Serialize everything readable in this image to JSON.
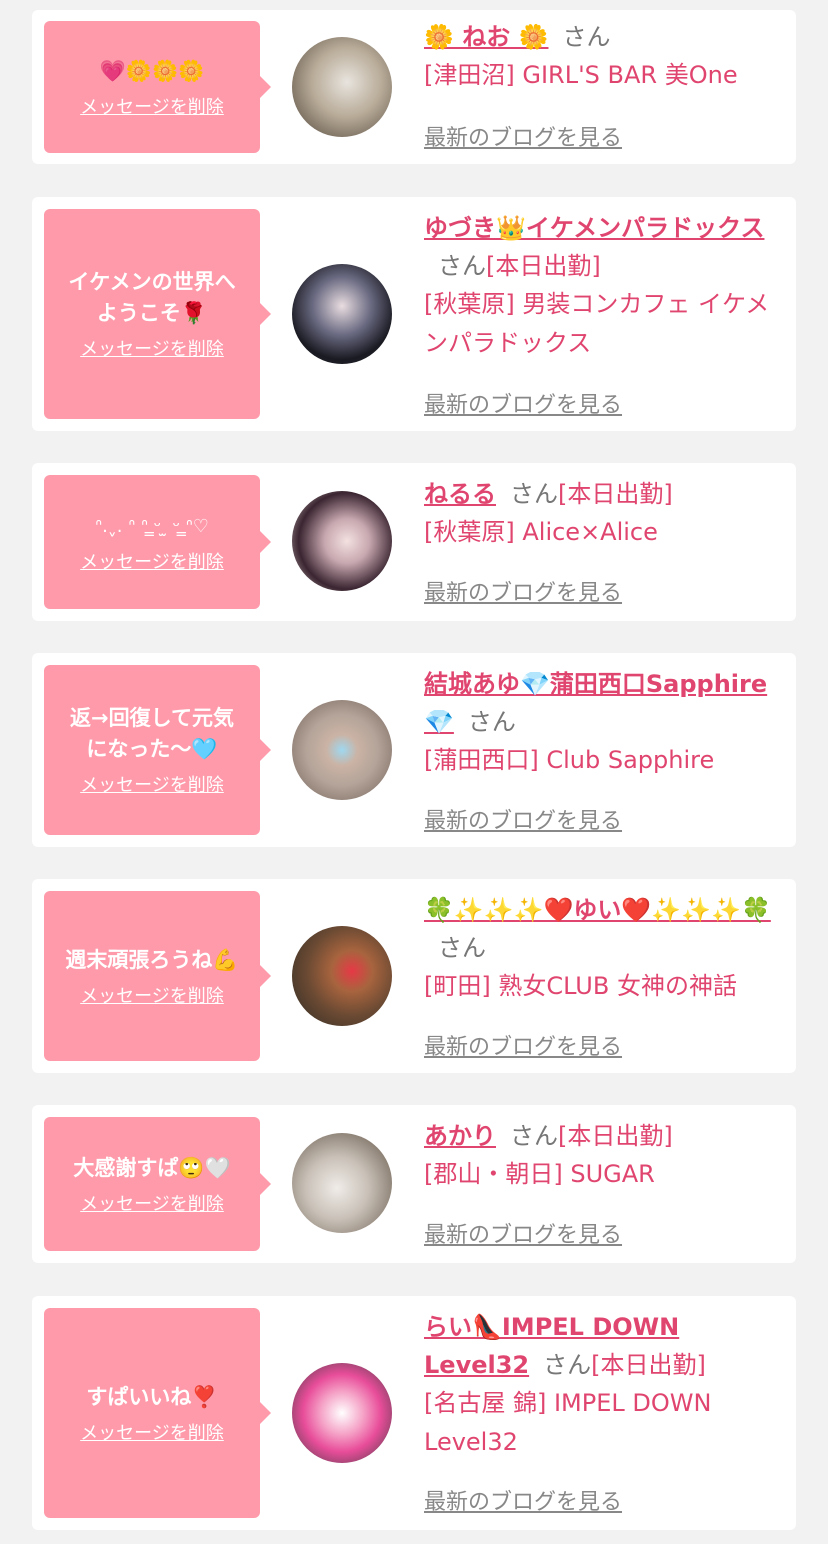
{
  "common": {
    "delete_label": "メッセージを削除",
    "blog_label": "最新のブログを見る",
    "san": "さん"
  },
  "cards": [
    {
      "message": "💗🌼🌼🌼",
      "name": "🌼 ねお 🌼",
      "status": "",
      "shop": "[津田沼] GIRL'S BAR 美One"
    },
    {
      "message": "イケメンの世界へ\nようこそ🌹",
      "name": "ゆづき👑イケメンパラドックス",
      "status": "[本日出勤]",
      "shop": "[秋葉原] 男装コンカフェ イケメンパラドックス"
    },
    {
      "message": "ᐢ.ˬ. ᐢ ᐢ ̳ᵕ ̫ ᵕ ̳ᐢ♡",
      "name": "ねるる",
      "status": "[本日出勤]",
      "shop": "[秋葉原] Alice×Alice"
    },
    {
      "message": "返→回復して元気\nになった〜🩵",
      "name": "結城あゆ💎蒲田西口Sapphire💎",
      "status": "",
      "shop": "[蒲田西口] Club Sapphire"
    },
    {
      "message": "週末頑張ろうね💪",
      "name": "🍀✨✨✨❤️ゆい❤️✨✨✨🍀",
      "status": "",
      "shop": "[町田] 熟女CLUB 女神の神話"
    },
    {
      "message": "大感謝すぱ🙄🤍",
      "name": "あかり",
      "status": "[本日出勤]",
      "shop": "[郡山・朝日] SUGAR"
    },
    {
      "message": "すぱいいね❣️",
      "name": "らい👠IMPEL DOWN Level32",
      "status": "[本日出勤]",
      "shop": "[名古屋 錦] IMPEL DOWN Level32"
    }
  ]
}
